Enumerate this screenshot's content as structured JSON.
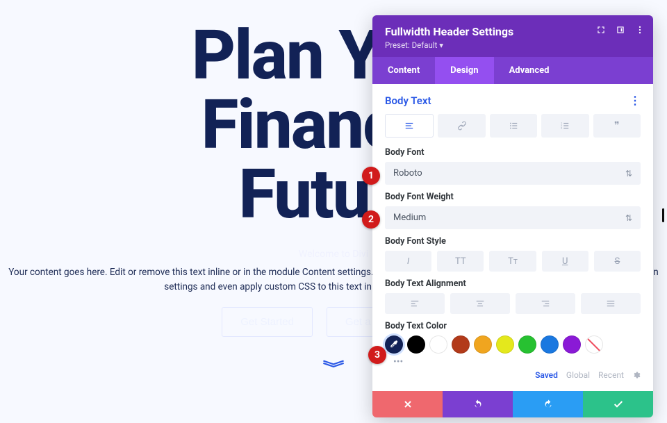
{
  "hero": {
    "title_line1": "Plan Your",
    "title_line2": "Financial",
    "title_line3": "Future",
    "subtitle": "Welcome to Divi",
    "body": "Your content goes here. Edit or remove this text inline or in the module Content settings. You can also style every aspect of this content in the module Design settings and even apply custom CSS to this text in the module Advanced settings.",
    "cta1": "Get Started",
    "cta2": "Get a Free Quote"
  },
  "panel": {
    "title": "Fullwidth Header Settings",
    "preset": "Preset: Default ▾",
    "tabs": {
      "content": "Content",
      "design": "Design",
      "advanced": "Advanced"
    },
    "section": "Body Text",
    "labels": {
      "body_font": "Body Font",
      "body_font_weight": "Body Font Weight",
      "body_font_style": "Body Font Style",
      "body_text_alignment": "Body Text Alignment",
      "body_text_color": "Body Text Color"
    },
    "body_font_value": "Roboto",
    "body_font_weight_value": "Medium",
    "style_buttons": {
      "italic": "I",
      "uppercase": "TT",
      "smallcaps": "Tᴛ",
      "underline": "U",
      "strike": "S"
    },
    "colors": {
      "selected": "#122256",
      "palette": [
        "#122256",
        "#000000",
        "#ffffff",
        "#b23a1a",
        "#f0a51f",
        "#e4e81c",
        "#27c131",
        "#1a78e0",
        "#8a1ad6"
      ]
    },
    "saved": {
      "saved": "Saved",
      "global": "Global",
      "recent": "Recent"
    }
  },
  "callouts": {
    "c1": "1",
    "c2": "2",
    "c3": "3"
  }
}
